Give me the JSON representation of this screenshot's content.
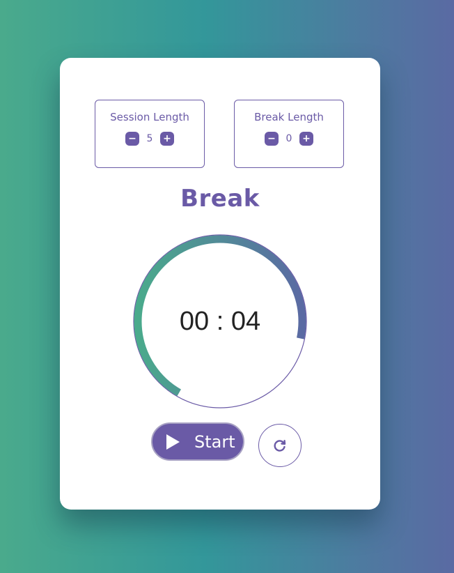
{
  "session": {
    "label": "Session Length",
    "value": "5",
    "decrement": "−",
    "increment": "+"
  },
  "break_len": {
    "label": "Break Length",
    "value": "0",
    "decrement": "−",
    "increment": "+"
  },
  "mode": "Break",
  "timer": {
    "display": "00 : 04",
    "progress": 0.7
  },
  "controls": {
    "start_label": "Start",
    "reset_icon": "reset-icon"
  },
  "colors": {
    "accent": "#6a5aa6",
    "ring_start": "#5a6aa3",
    "ring_end": "#4aaa8c"
  }
}
